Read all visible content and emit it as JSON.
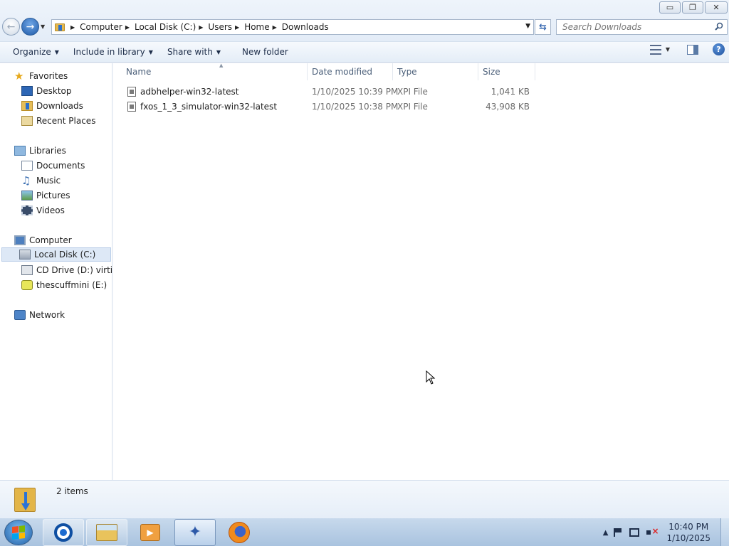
{
  "window": {
    "minimize_glyph": "▭",
    "restore_glyph": "❐",
    "close_glyph": "✕"
  },
  "address": {
    "crumbs": [
      "Computer",
      "Local Disk (C:)",
      "Users",
      "Home",
      "Downloads"
    ],
    "refresh_glyph": "⇆"
  },
  "search": {
    "placeholder": "Search Downloads"
  },
  "toolbar": {
    "organize": "Organize",
    "include_in_library": "Include in library",
    "share_with": "Share with",
    "new_folder": "New folder"
  },
  "nav": {
    "favorites": "Favorites",
    "desktop": "Desktop",
    "downloads": "Downloads",
    "recent_places": "Recent Places",
    "libraries": "Libraries",
    "documents": "Documents",
    "music": "Music",
    "pictures": "Pictures",
    "videos": "Videos",
    "computer": "Computer",
    "local_disk": "Local Disk (C:)",
    "cd_drive": "CD Drive (D:) virtio-w",
    "usb": "thescuffmini (E:)",
    "network": "Network"
  },
  "columns": {
    "name": "Name",
    "date_modified": "Date modified",
    "type": "Type",
    "size": "Size"
  },
  "files": [
    {
      "name": "adbhelper-win32-latest",
      "date": "1/10/2025 10:39 PM",
      "type": "XPI File",
      "size": "1,041 KB"
    },
    {
      "name": "fxos_1_3_simulator-win32-latest",
      "date": "1/10/2025 10:38 PM",
      "type": "XPI File",
      "size": "43,908 KB"
    }
  ],
  "status": {
    "item_count": "2 items"
  },
  "clock": {
    "time": "10:40 PM",
    "date": "1/10/2025"
  },
  "colors": {
    "selection": "#dde8f6",
    "taskbar": "#a9c3df",
    "accent": "#1f5ea5"
  }
}
